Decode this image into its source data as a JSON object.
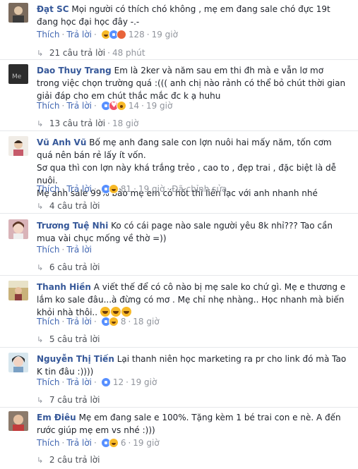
{
  "actions": {
    "like": "Thích",
    "reply": "Trả lời",
    "edited": "Đã chỉnh sửa"
  },
  "comments": [
    {
      "name": "Đạt SC",
      "text": "Mọi người có thích chó không , mẹ em đang sale chó đực 19t đang học đại học đây -.-",
      "count": "128",
      "time": "19 giờ",
      "reactions": [
        "haha",
        "like",
        "angry"
      ],
      "replies": "21 câu trả lời",
      "reply_time": "48 phút"
    },
    {
      "name": "Dao Thuy Trang",
      "text": "Em là 2ker và năm sau em thi đh mà e vẫn lơ mơ trong việc chọn trường quá :((( anh chị nào rảnh có thể bỏ chút thời gian giải đáp cho em chút thắc mắc đc k ạ huhu",
      "count": "14",
      "time": "19 giờ",
      "reactions": [
        "like",
        "love",
        "wow"
      ],
      "replies": "13 câu trả lời",
      "reply_time": "18 giờ"
    },
    {
      "name": "Vũ Anh Vũ",
      "text_lines": [
        "Bố mẹ anh đang sale con lợn nuôi hai mấy năm, tốn cơm quá nên bán rẻ lấy ít vốn.",
        "Sơ qua thì con lợn này khá trắng trẻo , cao to , đẹp trai , đặc biệt là dễ nuôi.",
        "Mẹ anh sale 99% bảo mẹ em có hốt thì liên lạc với anh nhanh nhé"
      ],
      "count": "81",
      "time": "19 giờ",
      "reactions": [
        "like",
        "haha"
      ],
      "replies": "4 câu trả lời"
    },
    {
      "name": "Trương Tuệ Nhi",
      "text": "Ko có cái page nào sale người yêu 8k nhỉ??? Tao cần mua vài chục mống về thờ =))",
      "replies": "6 câu trả lời"
    },
    {
      "name": "Thanh Hiền",
      "text": "A viết thế để có cô nào bị mẹ sale ko chứ gì. Mẹ e thương e lắm ko sale đâu...à đừng có mơ . Mẹ chỉ nhẹ nhàng.. Học nhanh mà biến khỏi nhà thôi..",
      "count": "8",
      "time": "18 giờ",
      "reactions": [
        "like",
        "haha"
      ],
      "replies": "5 câu trả lời"
    },
    {
      "name": "Nguyễn Thị Tiến",
      "text": "Lại thanh niên học marketing ra pr cho link đó mà Tao K tin đâu :))))",
      "count": "12",
      "time": "19 giờ",
      "reactions": [
        "like"
      ],
      "replies": "7 câu trả lời"
    },
    {
      "name": "Em Điêu",
      "text": "Mẹ em đang sale e 100%. Tặng kèm 1 bé trai con e nè. A đến rước giúp mẹ em vs nhé :)))",
      "count": "6",
      "time": "19 giờ",
      "reactions": [
        "like",
        "haha"
      ],
      "replies": "2 câu trả lời"
    }
  ]
}
